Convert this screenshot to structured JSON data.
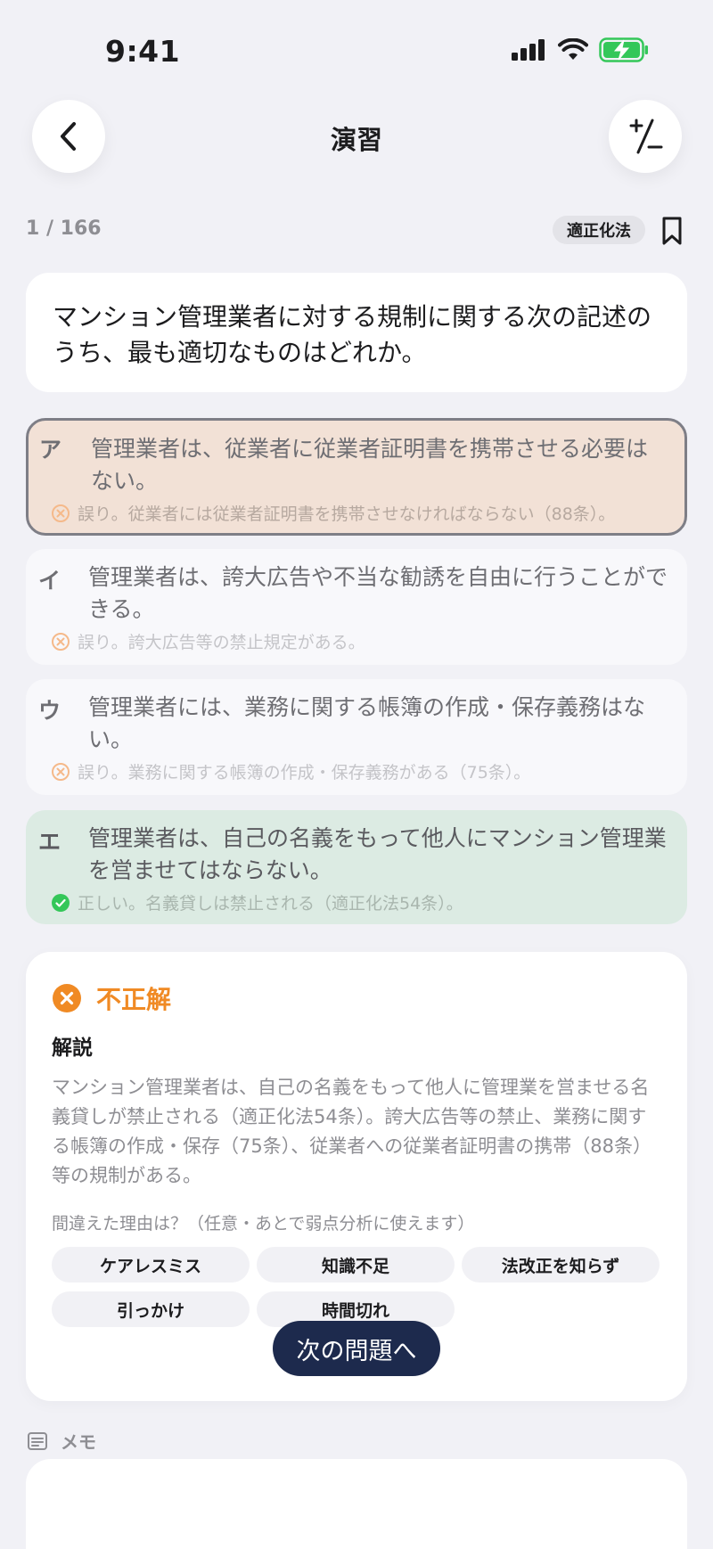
{
  "status_bar": {
    "time": "9:41"
  },
  "nav": {
    "title": "演習"
  },
  "progress": {
    "text": "1 / 166",
    "tag": "適正化法"
  },
  "question": {
    "text": "マンション管理業者に対する規制に関する次の記述のうち、最も適切なものはどれか。"
  },
  "options": [
    {
      "letter": "ア",
      "text": "管理業者は、従業者に従業者証明書を携帯させる必要はない。",
      "feedback": "誤り。従業者には従業者証明書を携帯させなければならない（88条）。",
      "status": "wrong-selected"
    },
    {
      "letter": "イ",
      "text": "管理業者は、誇大広告や不当な勧誘を自由に行うことができる。",
      "feedback": "誤り。誇大広告等の禁止規定がある。",
      "status": "wrong"
    },
    {
      "letter": "ウ",
      "text": "管理業者には、業務に関する帳簿の作成・保存義務はない。",
      "feedback": "誤り。業務に関する帳簿の作成・保存義務がある（75条）。",
      "status": "wrong"
    },
    {
      "letter": "エ",
      "text": "管理業者は、自己の名義をもって他人にマンション管理業を営ませてはならない。",
      "feedback": "正しい。名義貸しは禁止される（適正化法54条）。",
      "status": "correct"
    }
  ],
  "result": {
    "label": "不正解",
    "explanation_title": "解説",
    "explanation": "マンション管理業者は、自己の名義をもって他人に管理業を営ませる名義貸しが禁止される（適正化法54条）。誇大広告等の禁止、業務に関する帳簿の作成・保存（75条）、従業者への従業者証明書の携帯（88条）等の規制がある。",
    "reason_question": "間違えた理由は？（任意・あとで弱点分析に使えます）",
    "reasons": [
      "ケアレスミス",
      "知識不足",
      "法改正を知らず",
      "引っかけ",
      "時間切れ"
    ],
    "next_label": "次の問題へ"
  },
  "memo": {
    "label": "メモ"
  },
  "colors": {
    "accent_orange": "#f08a24",
    "correct_green": "#34c759",
    "navy": "#1d2a4d"
  }
}
